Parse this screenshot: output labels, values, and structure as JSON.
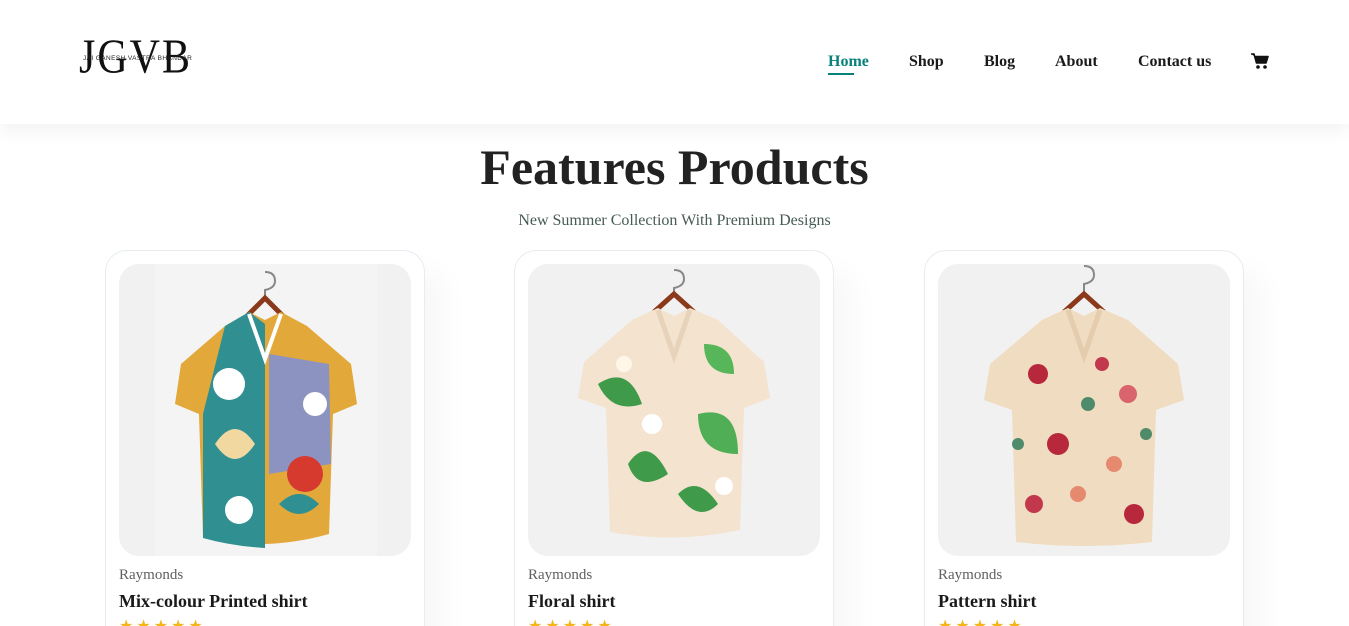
{
  "brand": {
    "logo_letters": "JGVB",
    "logo_subtitle": "JAI GANESH VASTRA BHANDAR"
  },
  "nav": {
    "items": [
      {
        "label": "Home",
        "active": true
      },
      {
        "label": "Shop",
        "active": false
      },
      {
        "label": "Blog",
        "active": false
      },
      {
        "label": "About",
        "active": false
      },
      {
        "label": "Contact us",
        "active": false
      }
    ],
    "cart_icon": "shopping-cart-icon"
  },
  "section": {
    "title": "Features Products",
    "subtitle": "New Summer Collection With Premium Designs"
  },
  "products": [
    {
      "brand": "Raymonds",
      "title": "Mix-colour Printed shirt",
      "rating": 5,
      "image_icon": "printed-shirt-image"
    },
    {
      "brand": "Raymonds",
      "title": "Floral shirt",
      "rating": 5,
      "image_icon": "floral-shirt-image"
    },
    {
      "brand": "Raymonds",
      "title": "Pattern shirt",
      "rating": 5,
      "image_icon": "pattern-shirt-image"
    }
  ],
  "colors": {
    "accent": "#088178",
    "star": "#f3b519",
    "card_bg": "#f1f1f1"
  }
}
